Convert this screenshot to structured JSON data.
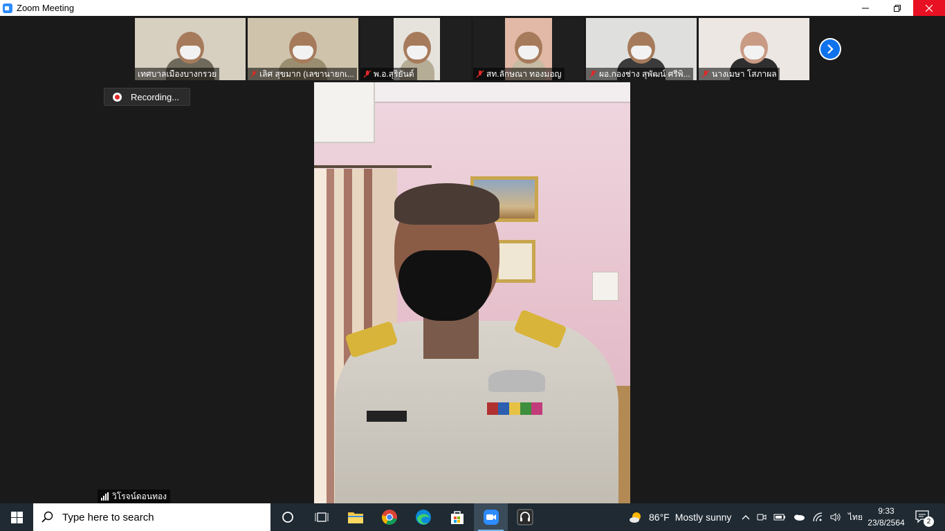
{
  "window": {
    "title": "Zoom Meeting",
    "minimize_icon": "minimize-icon",
    "restore_icon": "restore-icon",
    "close_icon": "close-icon"
  },
  "participants": [
    {
      "name": "เทศบาลเมืองบางกรวย",
      "muted": false,
      "bg": "#d7cfc0",
      "shirt": "#6f6a5c"
    },
    {
      "name": "เลิศ สุขมาก (เลขานายกเ...",
      "muted": true,
      "bg": "#cfc3ac",
      "shirt": "#9a8d70"
    },
    {
      "name": "พ.อ.สุริยันต์",
      "muted": true,
      "bg": "#e6e3dd",
      "shirt": "#b6ad97"
    },
    {
      "name": "สท.ลักษณา ทองมอญ",
      "muted": true,
      "bg": "#e2b9a6",
      "shirt": "#c7bba3"
    },
    {
      "name": "ผอ.กองช่าง สุพัฒน์ ศรีพิ...",
      "muted": true,
      "bg": "#dfe0dd",
      "shirt": "#3b3b3b"
    },
    {
      "name": "นางเมษา โสภาผล",
      "muted": true,
      "bg": "#ece7e3",
      "shirt": "#2f2f2f"
    }
  ],
  "next_page_icon": "chevron-right-icon",
  "recording": {
    "label": "Recording..."
  },
  "active_speaker": {
    "name": "วิโรจน์ดอนทอง"
  },
  "taskbar": {
    "search_placeholder": "Type here to search",
    "weather_temp": "86°F",
    "weather_text": "Mostly sunny",
    "language": "ไทย",
    "time": "9:33",
    "date": "23/8/2564",
    "notification_count": "2"
  },
  "colors": {
    "zoom_blue": "#2d8cff",
    "recording_red": "#e02828",
    "close_red": "#e81123"
  }
}
